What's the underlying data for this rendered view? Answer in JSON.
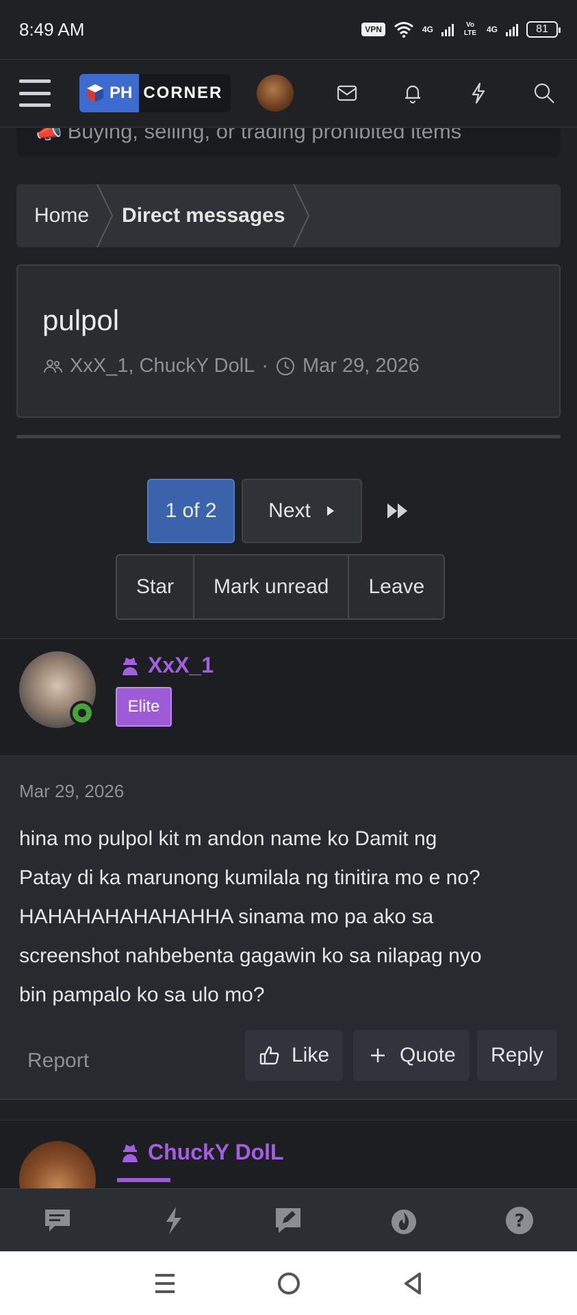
{
  "status_bar": {
    "time": "8:49 AM",
    "vpn": "VPN",
    "net1": "4G",
    "net2": "Vo LTE",
    "net3": "4G",
    "battery": "81"
  },
  "header": {
    "logo_ph": "PH",
    "logo_corner": "CORNER"
  },
  "notice": {
    "text": "Buying, selling, or trading prohibited items"
  },
  "breadcrumb": {
    "home": "Home",
    "current": "Direct messages"
  },
  "conversation": {
    "title": "pulpol",
    "participants": "XxX_1, ChuckY DolL",
    "separator": "·",
    "date": "Mar 29, 2026"
  },
  "pager": {
    "current": "1 of 2",
    "next": "Next"
  },
  "actions": {
    "star": "Star",
    "mark_unread": "Mark unread",
    "leave": "Leave"
  },
  "message1": {
    "author": "XxX_1",
    "badge": "Elite",
    "date": "Mar 29, 2026",
    "lines": [
      "hina mo pulpol kit m andon name ko Damit ng",
      "Patay di ka marunong kumilala ng tinitira mo e no?",
      "HAHAHAHAHAHAHHA sinama mo pa ako sa",
      "screenshot nahbebenta gagawin ko sa nilapag nyo",
      "bin pampalo ko sa ulo mo?"
    ],
    "report": "Report",
    "like": "Like",
    "quote": "Quote",
    "reply": "Reply"
  },
  "message2": {
    "author": "ChuckY DolL"
  },
  "colors": {
    "accent_blue": "#3b63ab",
    "username_purple": "#a45ee0",
    "online_green": "#47a33a"
  }
}
